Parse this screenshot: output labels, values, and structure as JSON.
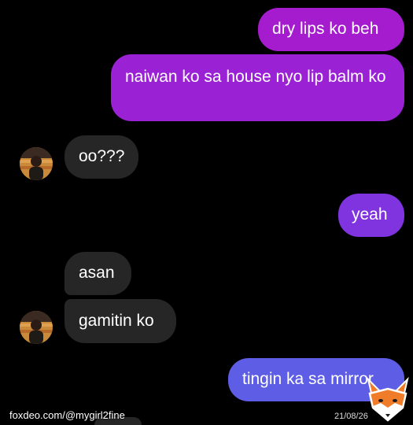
{
  "messages": [
    {
      "side": "out",
      "text": "dry lips ko beh"
    },
    {
      "side": "out",
      "text": "naiwan ko sa house nyo lip balm ko"
    },
    {
      "side": "in",
      "text": "oo???"
    },
    {
      "side": "out",
      "text": "yeah"
    },
    {
      "side": "in",
      "text": "asan"
    },
    {
      "side": "in",
      "text": "gamitin ko"
    },
    {
      "side": "out",
      "text": "tingin ka sa mirror"
    }
  ],
  "watermark": {
    "text": "foxdeo.com/@mygirl2fine",
    "date": "21/08/26"
  },
  "colors": {
    "outgoing_top": "#a41ed0",
    "outgoing_mid": "#8a2ee0",
    "outgoing_bottom": "#5e5ee6",
    "incoming": "#262626",
    "background": "#000000"
  },
  "icons": {
    "logo": "fox-logo-icon",
    "avatar": "contact-avatar"
  }
}
